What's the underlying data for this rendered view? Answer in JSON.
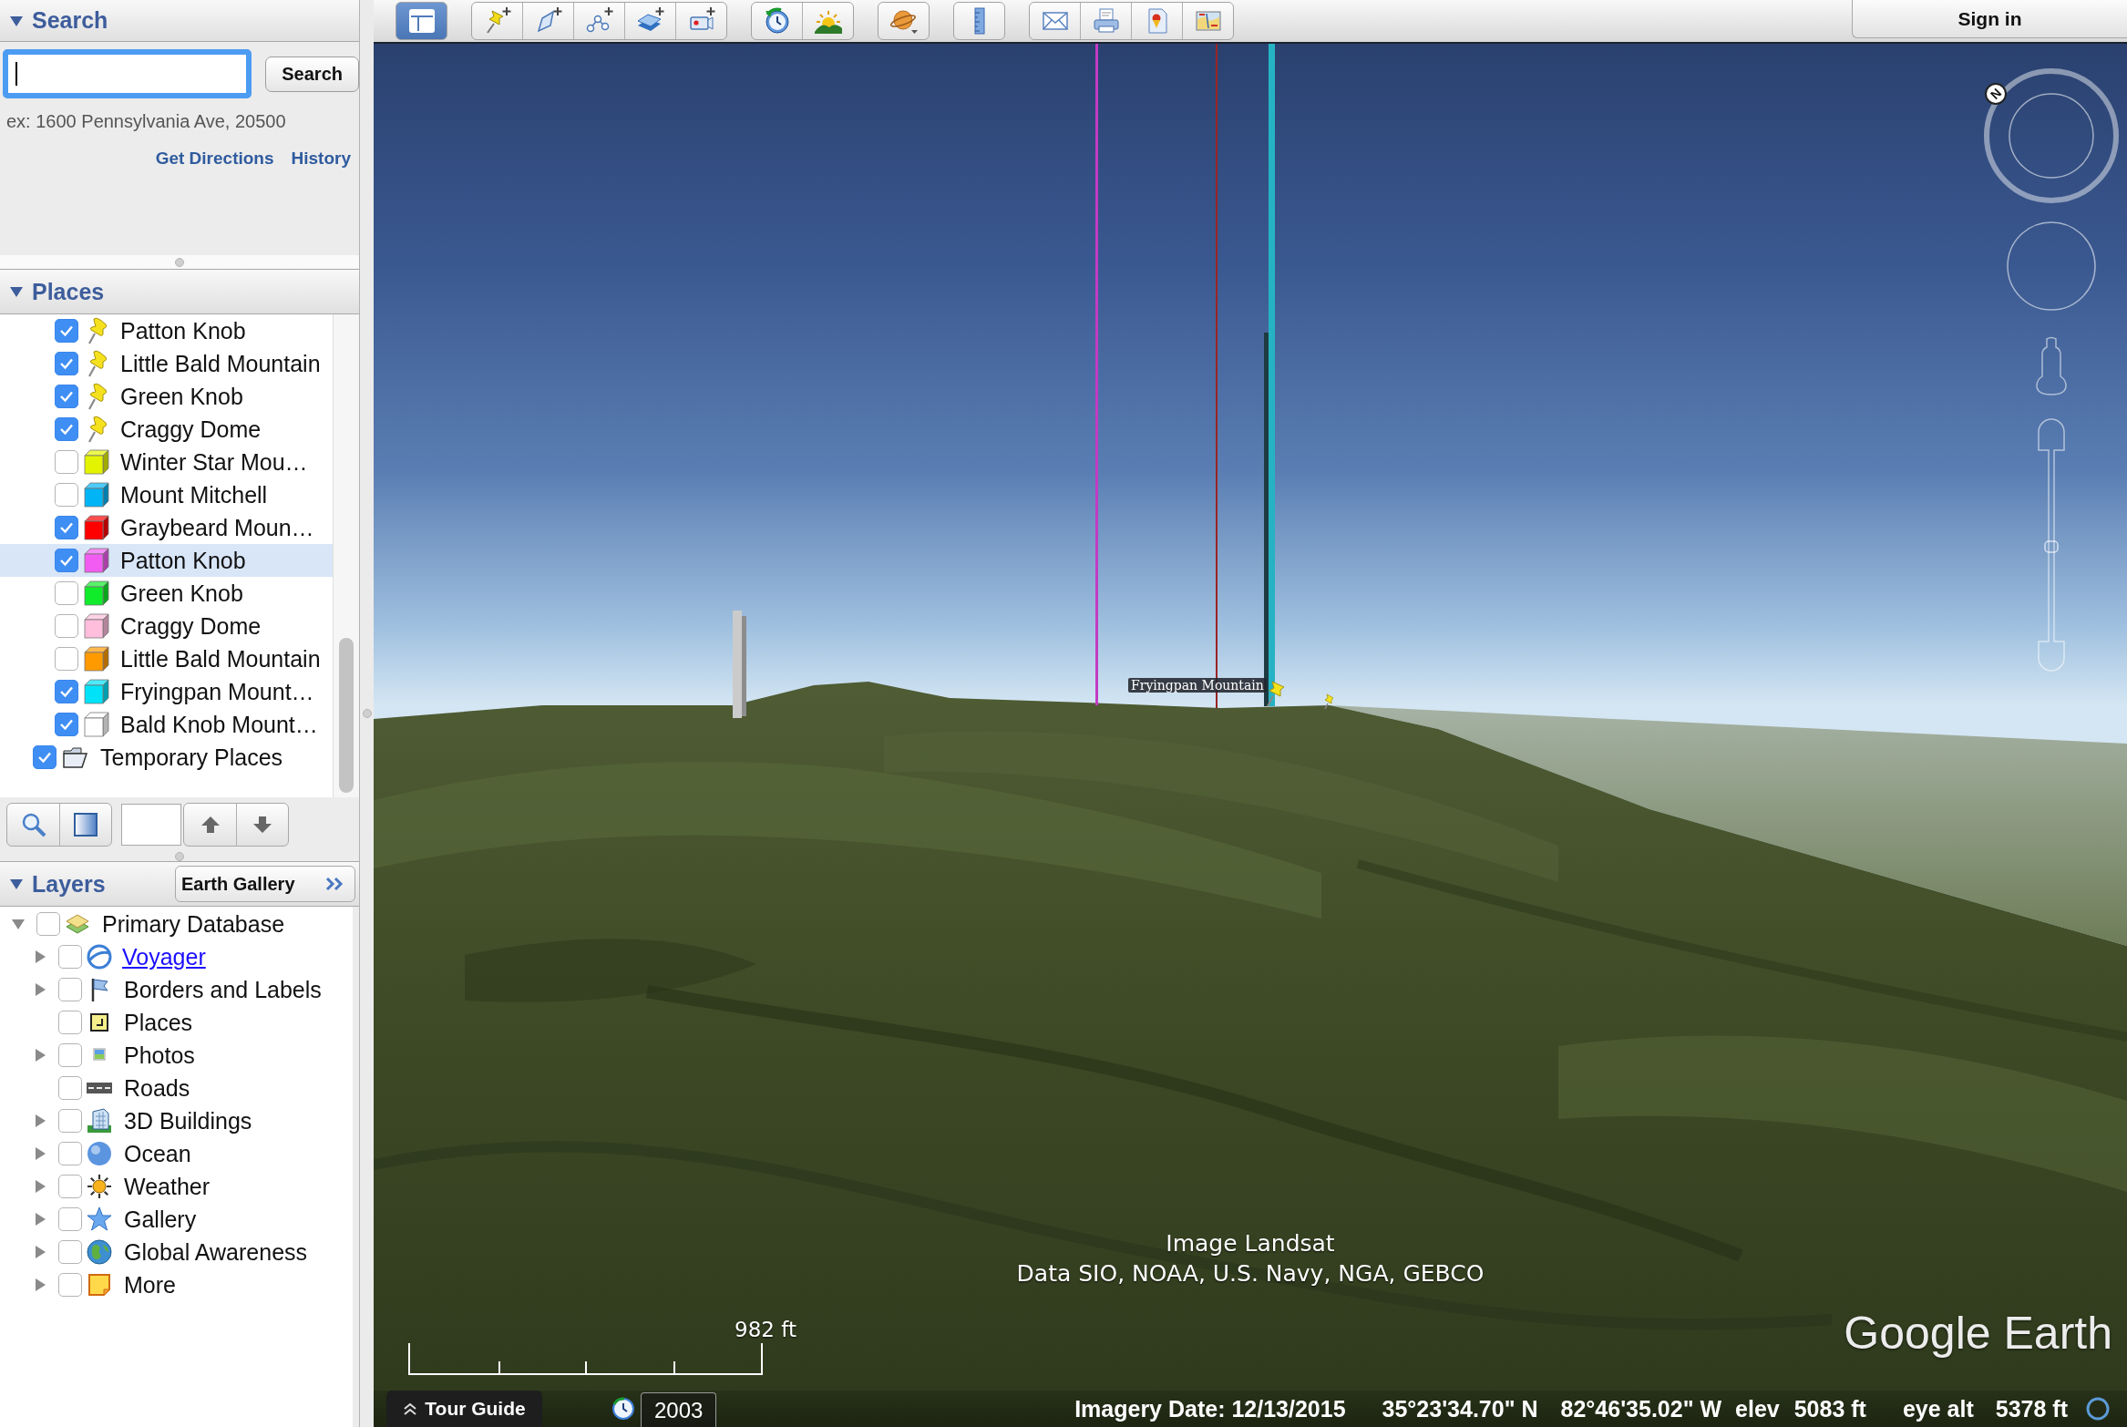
{
  "toolbar": {
    "groups": [
      [
        {
          "kind": "sidebar",
          "on": true
        }
      ],
      [
        {
          "kind": "placemark",
          "on": false
        },
        {
          "kind": "polygon",
          "on": false
        },
        {
          "kind": "path",
          "on": false
        },
        {
          "kind": "overlay",
          "on": false
        },
        {
          "kind": "tour",
          "on": false
        }
      ],
      [
        {
          "kind": "history",
          "on": false
        },
        {
          "kind": "sunlight",
          "on": false
        }
      ],
      [
        {
          "kind": "planets",
          "on": false
        }
      ],
      [
        {
          "kind": "ruler",
          "on": false
        }
      ],
      [
        {
          "kind": "email",
          "on": false
        },
        {
          "kind": "print",
          "on": false
        },
        {
          "kind": "maps",
          "on": false
        },
        {
          "kind": "image",
          "on": false
        }
      ]
    ],
    "sign_in": "Sign in"
  },
  "search": {
    "title": "Search",
    "expanded": true,
    "field": {
      "focused": true
    },
    "button": "Search",
    "hint": "ex: 1600 Pennsylvania Ave, 20500",
    "links": [
      "Get Directions",
      "History"
    ]
  },
  "places": {
    "title": "Places",
    "expanded": true,
    "items": [
      {
        "children": [
          {
            "label": "Patton Knob",
            "kind": "pin",
            "checked": true,
            "selected": false
          },
          {
            "label": "Little Bald Mountain",
            "kind": "pin",
            "checked": true,
            "selected": false
          },
          {
            "label": "Green Knob",
            "kind": "pin",
            "checked": true,
            "selected": false
          },
          {
            "label": "Craggy Dome",
            "kind": "pin",
            "checked": true,
            "selected": false
          },
          {
            "label": "Winter Star Mou…",
            "kind": "polygon",
            "color": "#e4f400",
            "checked": false,
            "selected": false
          },
          {
            "label": "Mount Mitchell",
            "kind": "polygon",
            "color": "#00b4f5",
            "checked": false,
            "selected": false
          },
          {
            "label": "Graybeard Moun…",
            "kind": "polygon",
            "color": "#ff0000",
            "checked": true,
            "selected": false
          },
          {
            "label": "Patton Knob",
            "kind": "polygon",
            "color": "#f25cf2",
            "checked": true,
            "selected": true
          },
          {
            "label": "Green Knob",
            "kind": "polygon",
            "color": "#10ec2a",
            "checked": false,
            "selected": false
          },
          {
            "label": "Craggy Dome",
            "kind": "polygon",
            "color": "#ffbedc",
            "checked": false,
            "selected": false
          },
          {
            "label": "Little Bald Mountain",
            "kind": "polygon",
            "color": "#ff9a00",
            "checked": false,
            "selected": false
          },
          {
            "label": "Fryingpan Mount…",
            "kind": "polygon",
            "color": "#00e2f8",
            "checked": true,
            "selected": false
          },
          {
            "label": "Bald Knob Mount…",
            "kind": "polygon",
            "color": "#ffffff",
            "checked": true,
            "selected": false
          }
        ]
      },
      {
        "label": "Temporary Places",
        "kind": "folder",
        "checked": true,
        "selected": false
      }
    ]
  },
  "layers": {
    "title": "Layers",
    "expanded": true,
    "gallery_button": "Earth Gallery",
    "items": [
      {
        "label": "Primary Database",
        "kind": "database",
        "checked": false,
        "expanded": true,
        "link": false,
        "children": [
          {
            "label": "Voyager",
            "kind": "voyager",
            "checked": false,
            "expanded": false,
            "link": true
          },
          {
            "label": "Borders and Labels",
            "kind": "flag",
            "checked": false,
            "expanded": false,
            "link": false
          },
          {
            "label": "Places",
            "kind": "places",
            "checked": false,
            "link": false
          },
          {
            "label": "Photos",
            "kind": "photos",
            "checked": false,
            "expanded": false,
            "link": false
          },
          {
            "label": "Roads",
            "kind": "roads",
            "checked": false,
            "link": false
          },
          {
            "label": "3D Buildings",
            "kind": "buildings",
            "checked": false,
            "expanded": false,
            "link": false
          },
          {
            "label": "Ocean",
            "kind": "ocean",
            "checked": false,
            "expanded": false,
            "link": false
          },
          {
            "label": "Weather",
            "kind": "weather",
            "checked": false,
            "expanded": false,
            "link": false
          },
          {
            "label": "Gallery",
            "kind": "gallery",
            "checked": false,
            "expanded": false,
            "link": false
          },
          {
            "label": "Global Awareness",
            "kind": "globe",
            "checked": false,
            "expanded": false,
            "link": false
          },
          {
            "label": "More",
            "kind": "more",
            "checked": false,
            "expanded": false,
            "link": false
          }
        ]
      }
    ]
  },
  "map": {
    "placemark_label": "Fryingpan Mountain",
    "north_label": "N",
    "zoom_slider": {
      "level": 0.5
    },
    "attribution": [
      "Image Landsat",
      "Data SIO, NOAA, U.S. Navy, NGA, GEBCO"
    ],
    "scale": "982 ft",
    "logo": "Google Earth"
  },
  "status": {
    "tour_guide": "Tour Guide",
    "year": "2003",
    "readouts": [
      "Imagery Date: 12/13/2015",
      "35°23'34.70\" N",
      "82°46'35.02\" W",
      "elev",
      "5083 ft",
      "eye alt",
      "5378 ft"
    ]
  }
}
